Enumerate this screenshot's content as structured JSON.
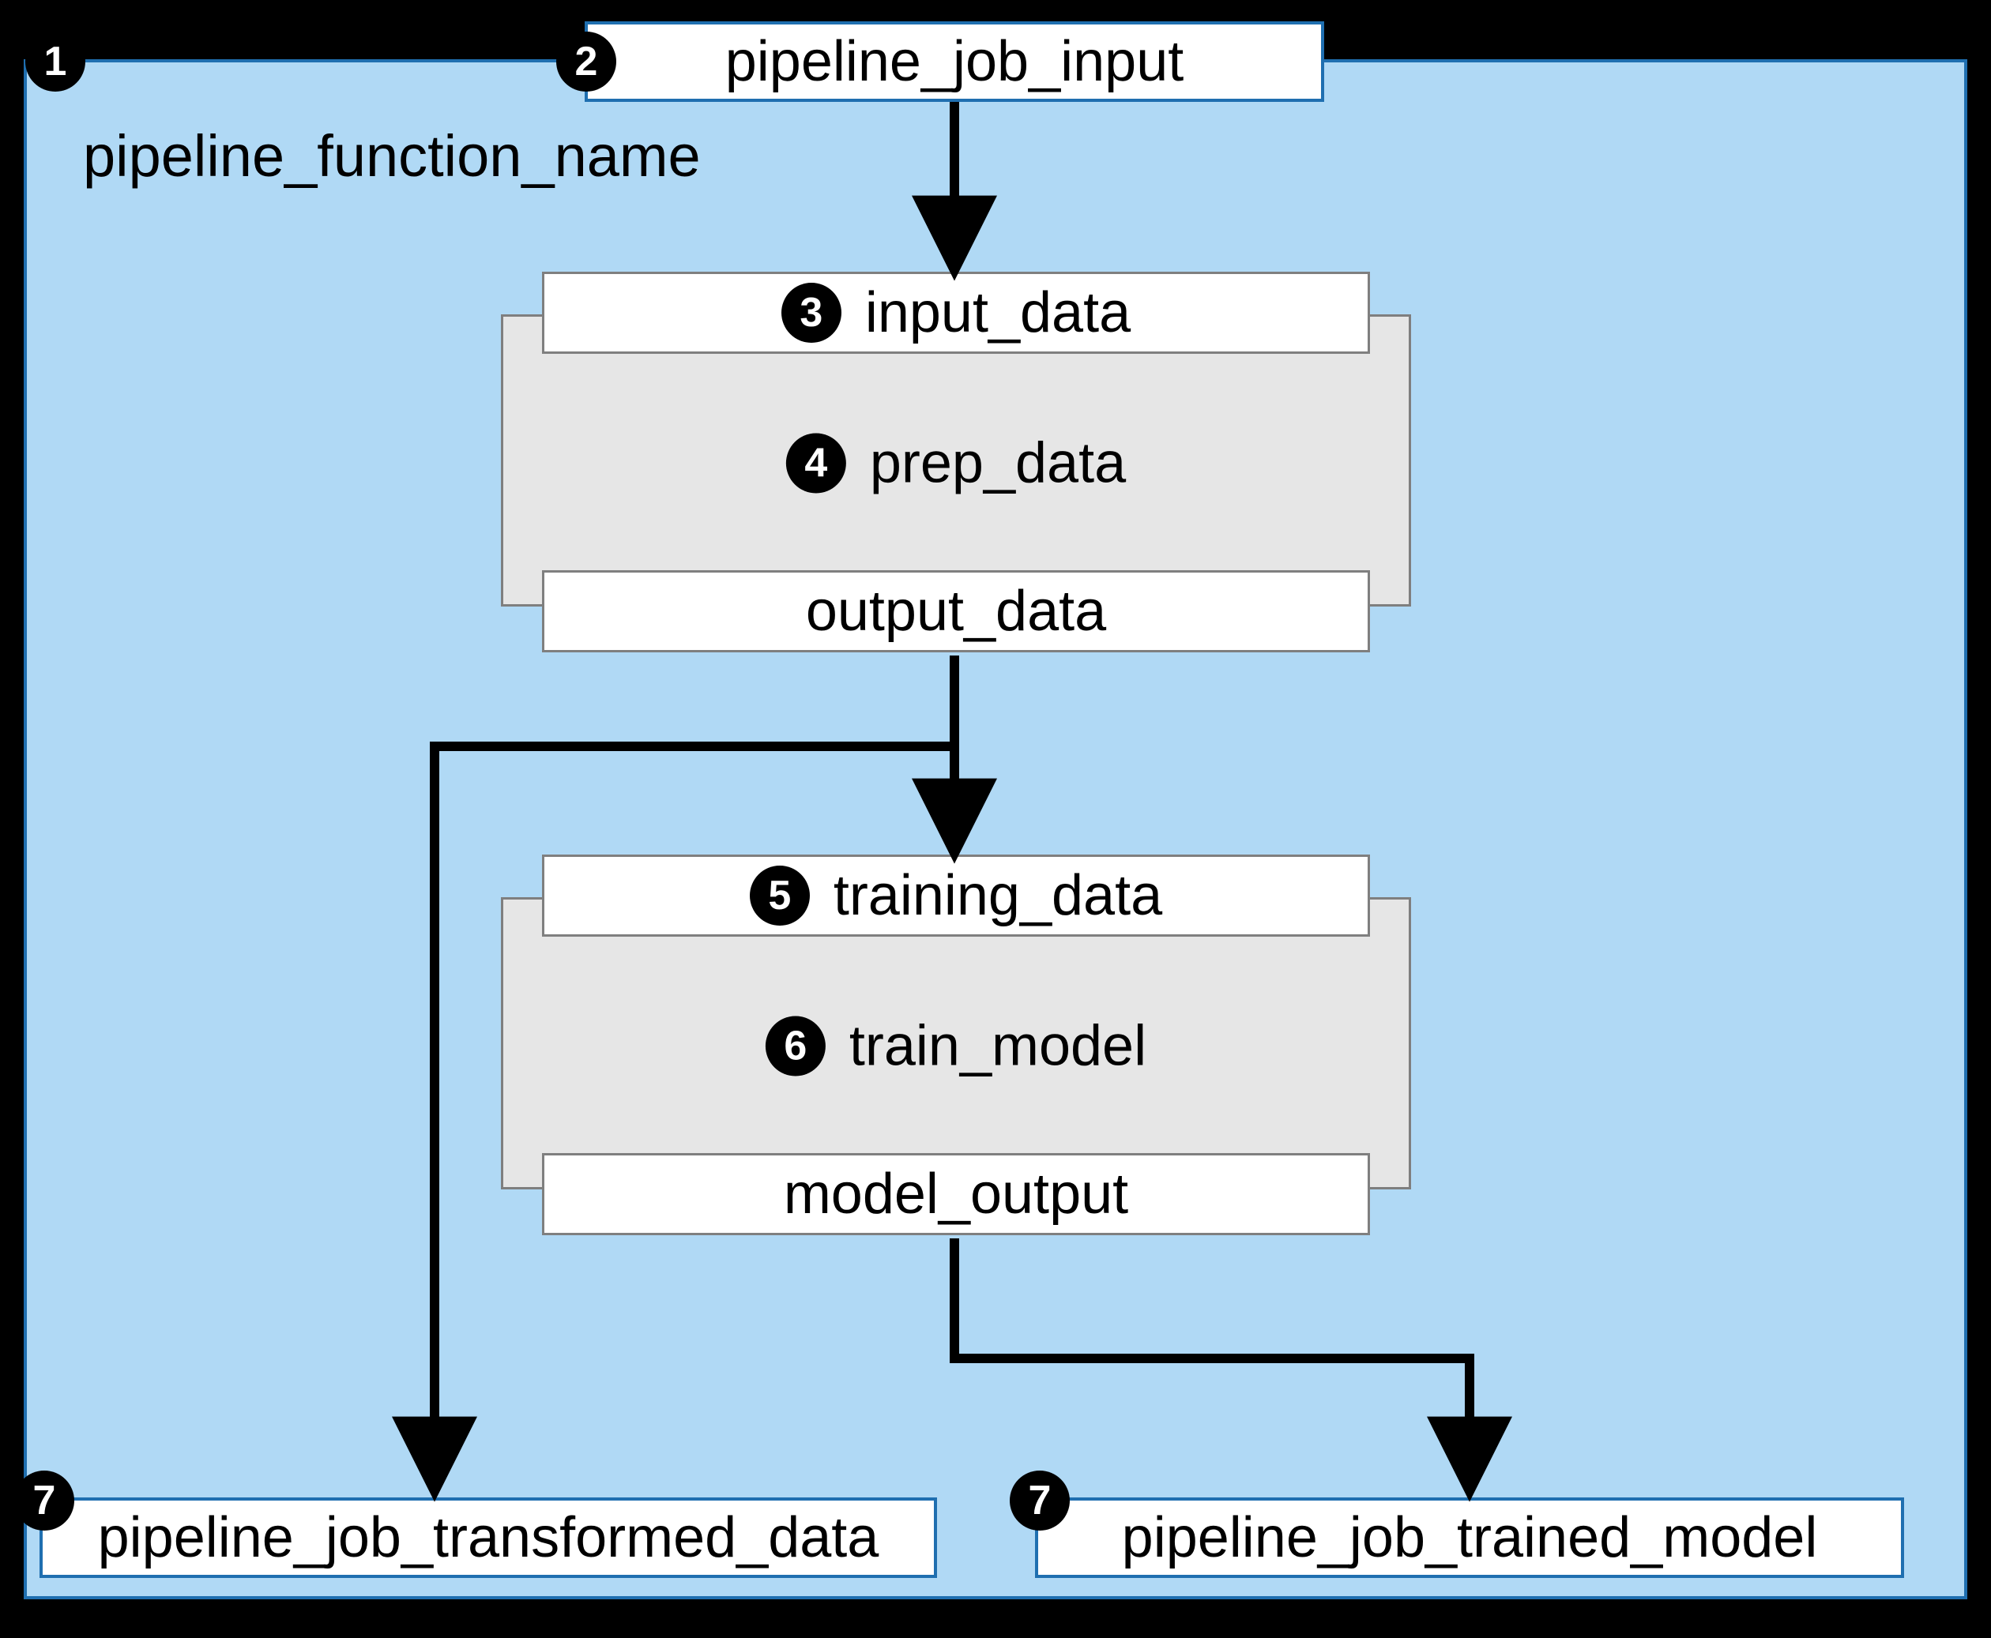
{
  "pipeline": {
    "function_name": "pipeline_function_name",
    "input_label": "pipeline_job_input",
    "outputs": {
      "transformed": "pipeline_job_transformed_data",
      "trained": "pipeline_job_trained_model"
    }
  },
  "components": {
    "prep": {
      "name": "prep_data",
      "input_label": "input_data",
      "output_label": "output_data"
    },
    "train": {
      "name": "train_model",
      "input_label": "training_data",
      "output_label": "model_output"
    }
  },
  "badges": {
    "b1": "1",
    "b2": "2",
    "b3": "3",
    "b4": "4",
    "b5": "5",
    "b6": "6",
    "b7a": "7",
    "b7b": "7"
  }
}
